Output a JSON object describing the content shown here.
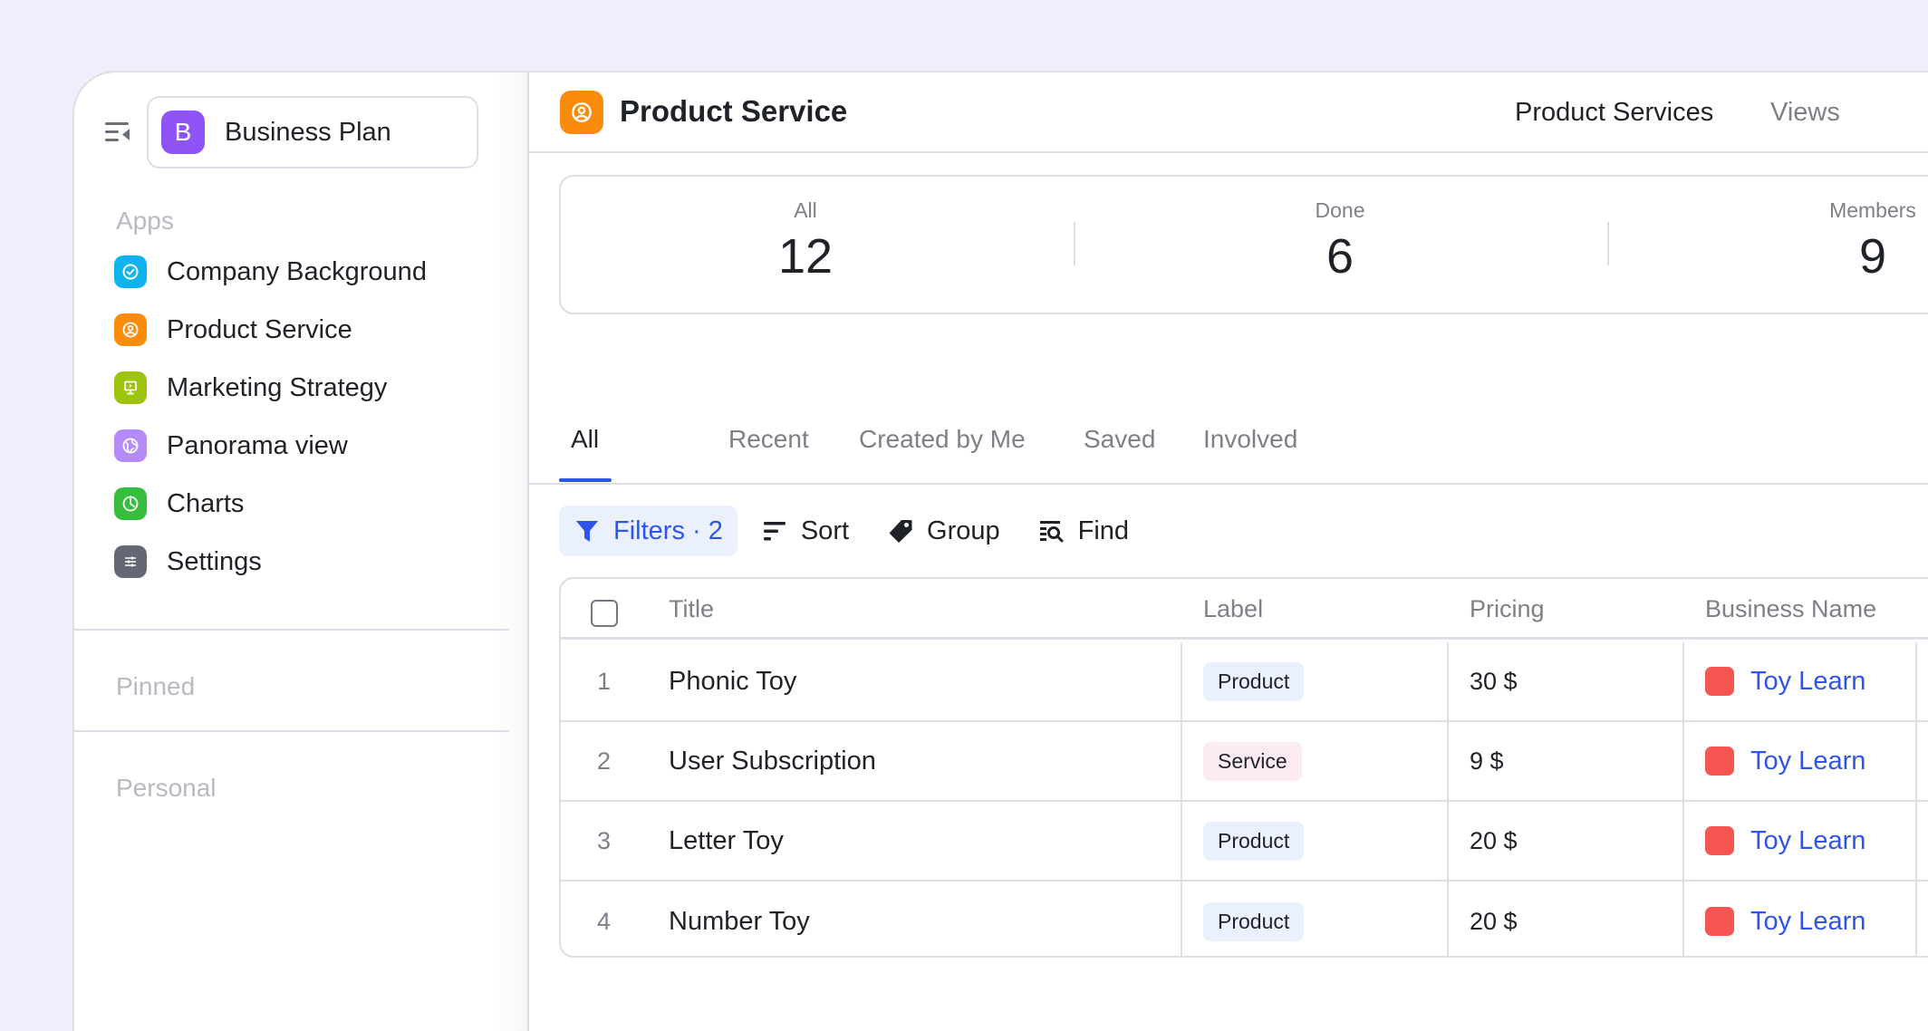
{
  "sidebar": {
    "workspace": {
      "initial": "B",
      "name": "Business Plan",
      "color": "#8e54f7"
    },
    "sections": {
      "apps": "Apps",
      "pinned": "Pinned",
      "personal": "Personal"
    },
    "items": [
      {
        "label": "Company Background",
        "icon": "check-circle-icon",
        "color": "#0fb4ef"
      },
      {
        "label": "Product Service",
        "icon": "user-circle-icon",
        "color": "#fb8b0c"
      },
      {
        "label": "Marketing Strategy",
        "icon": "presentation-icon",
        "color": "#9ec30e"
      },
      {
        "label": "Panorama view",
        "icon": "globe-icon",
        "color": "#b58bfb"
      },
      {
        "label": "Charts",
        "icon": "pie-chart-icon",
        "color": "#35bd3b"
      },
      {
        "label": "Settings",
        "icon": "sliders-icon",
        "color": "#636874"
      }
    ]
  },
  "header": {
    "title": "Product Service",
    "icon": "user-circle-icon",
    "icon_color": "#fb8b0c",
    "tabs": [
      {
        "label": "Product Services",
        "active": true
      },
      {
        "label": "Views",
        "active": false
      }
    ]
  },
  "stats": [
    {
      "label": "All",
      "value": "12"
    },
    {
      "label": "Done",
      "value": "6"
    },
    {
      "label": "Members",
      "value": "9"
    }
  ],
  "tabs": [
    {
      "label": "All",
      "active": true
    },
    {
      "label": "Recent",
      "active": false
    },
    {
      "label": "Created by Me",
      "active": false
    },
    {
      "label": "Saved",
      "active": false
    },
    {
      "label": "Involved",
      "active": false
    }
  ],
  "toolbar": {
    "filters": "Filters · 2",
    "sort": "Sort",
    "group": "Group",
    "find": "Find"
  },
  "table": {
    "columns": [
      "Title",
      "Label",
      "Pricing",
      "Business Name"
    ],
    "rows": [
      {
        "index": "1",
        "title": "Phonic Toy",
        "label": "Product",
        "pricing": "30 $",
        "business": "Toy Learn"
      },
      {
        "index": "2",
        "title": "User Subscription",
        "label": "Service",
        "pricing": "9 $",
        "business": "Toy Learn"
      },
      {
        "index": "3",
        "title": "Letter Toy",
        "label": "Product",
        "pricing": "20 $",
        "business": "Toy Learn"
      },
      {
        "index": "4",
        "title": "Number Toy",
        "label": "Product",
        "pricing": "20 $",
        "business": "Toy Learn"
      }
    ]
  },
  "colors": {
    "accent": "#2f54eb",
    "business_dot": "#f65652",
    "product_badge": "#ebf0fe",
    "service_badge": "#fdebf3"
  }
}
